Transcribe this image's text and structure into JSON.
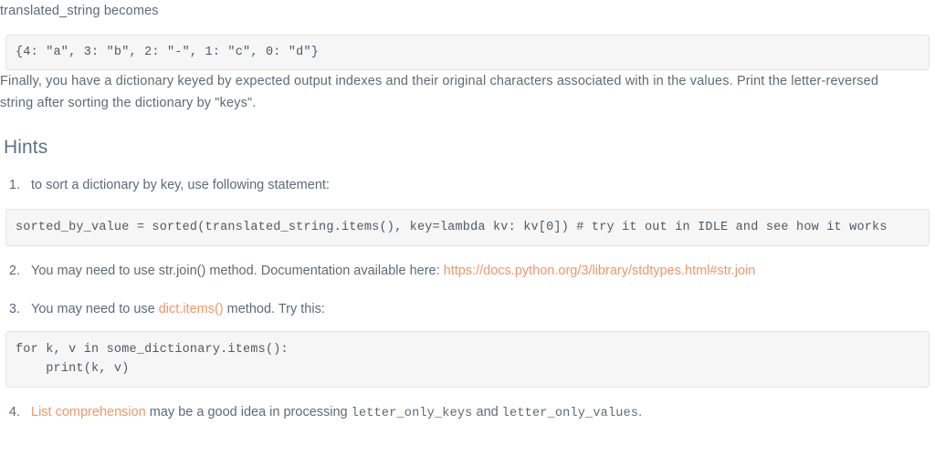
{
  "document": {
    "intro_paragraph": "translated_string becomes",
    "code_block_dict": "{4: \"a\", 3: \"b\", 2: \"-\", 1: \"c\", 0: \"d\"}",
    "explanation_paragraph": "Finally, you have a dictionary keyed by expected output indexes and their original characters associated with in the values. Print the letter-reversed string after sorting the dictionary by \"keys\".",
    "hints_heading": "Hints",
    "hints": {
      "item1_text": "to sort a dictionary by key, use following statement:",
      "code_block_sorted": "sorted_by_value = sorted(translated_string.items(), key=lambda kv: kv[0]) # try it out in IDLE and see how it works",
      "item2_prefix": "You may need to use str.join() method. Documentation available here: ",
      "item2_link": "https://docs.python.org/3/library/stdtypes.html#str.join",
      "item3_prefix": "You may need to use ",
      "item3_link": "dict.items()",
      "item3_suffix": " method. Try this:",
      "code_block_for_loop": "for k, v in some_dictionary.items():\n    print(k, v)",
      "item4_link": "List comprehension",
      "item4_mid": " may be a good idea in processing ",
      "item4_code1": "letter_only_keys",
      "item4_and": " and ",
      "item4_code2": "letter_only_values",
      "item4_end": "."
    }
  },
  "colors": {
    "body_text": "#5b6b77",
    "heading": "#5b7287",
    "link_orange": "#f0966a",
    "code_background": "#f6f6f6",
    "code_border": "#e4e4e4",
    "code_text": "#4d5a66",
    "page_background": "#ffffff"
  }
}
